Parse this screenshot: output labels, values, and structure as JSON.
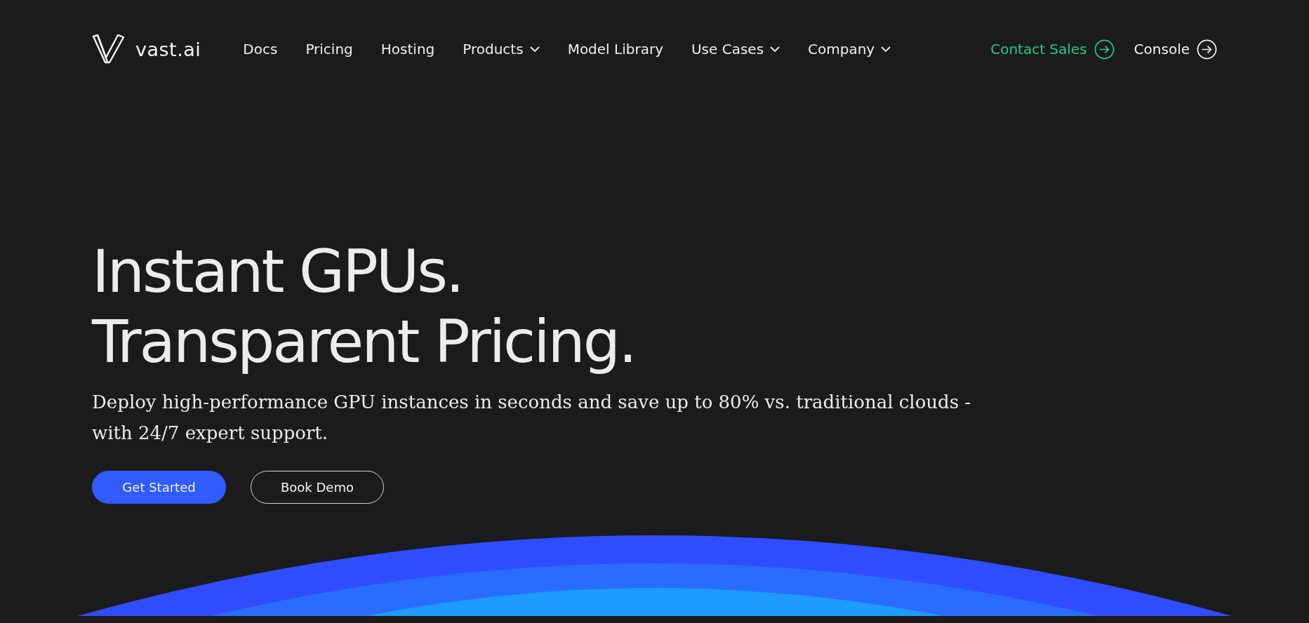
{
  "logo": {
    "text": "vast.ai"
  },
  "nav": [
    {
      "label": "Docs",
      "dropdown": false
    },
    {
      "label": "Pricing",
      "dropdown": false
    },
    {
      "label": "Hosting",
      "dropdown": false
    },
    {
      "label": "Products",
      "dropdown": true
    },
    {
      "label": "Model Library",
      "dropdown": false
    },
    {
      "label": "Use Cases",
      "dropdown": true
    },
    {
      "label": "Company",
      "dropdown": true
    }
  ],
  "actions": [
    {
      "label": "Contact Sales",
      "color": "#22c98a"
    },
    {
      "label": "Console",
      "color": "#f2f2f2"
    }
  ],
  "hero": {
    "headline": [
      "Instant GPUs.",
      "Transparent Pricing."
    ],
    "subtitle": "Deploy high-performance GPU instances in seconds and save up to 80% vs. traditional clouds - with 24/7 expert support.",
    "buttons": [
      {
        "label": "Get Started",
        "kind": "primary"
      },
      {
        "label": "Book Demo",
        "kind": "outline"
      }
    ]
  }
}
